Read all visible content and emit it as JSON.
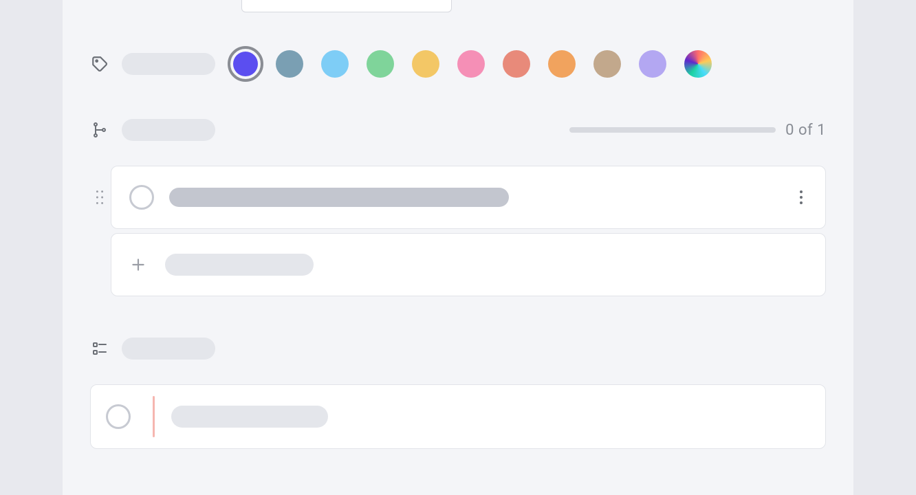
{
  "colorSection": {
    "colors": [
      {
        "hex": "#5b4ef0",
        "selected": true,
        "name": "purple"
      },
      {
        "hex": "#7a9fb3",
        "selected": false,
        "name": "steel-blue"
      },
      {
        "hex": "#7ecdf6",
        "selected": false,
        "name": "sky-blue"
      },
      {
        "hex": "#7fd49a",
        "selected": false,
        "name": "green"
      },
      {
        "hex": "#f3c766",
        "selected": false,
        "name": "yellow"
      },
      {
        "hex": "#f58fb6",
        "selected": false,
        "name": "pink"
      },
      {
        "hex": "#e88a7a",
        "selected": false,
        "name": "coral"
      },
      {
        "hex": "#f1a35e",
        "selected": false,
        "name": "orange"
      },
      {
        "hex": "#c2a88c",
        "selected": false,
        "name": "tan"
      },
      {
        "hex": "#b3a7f2",
        "selected": false,
        "name": "lavender"
      },
      {
        "hex": "rainbow",
        "selected": false,
        "name": "rainbow"
      }
    ]
  },
  "subtasks": {
    "progress": {
      "completed": 0,
      "total": 1,
      "label": "0 of 1"
    }
  }
}
